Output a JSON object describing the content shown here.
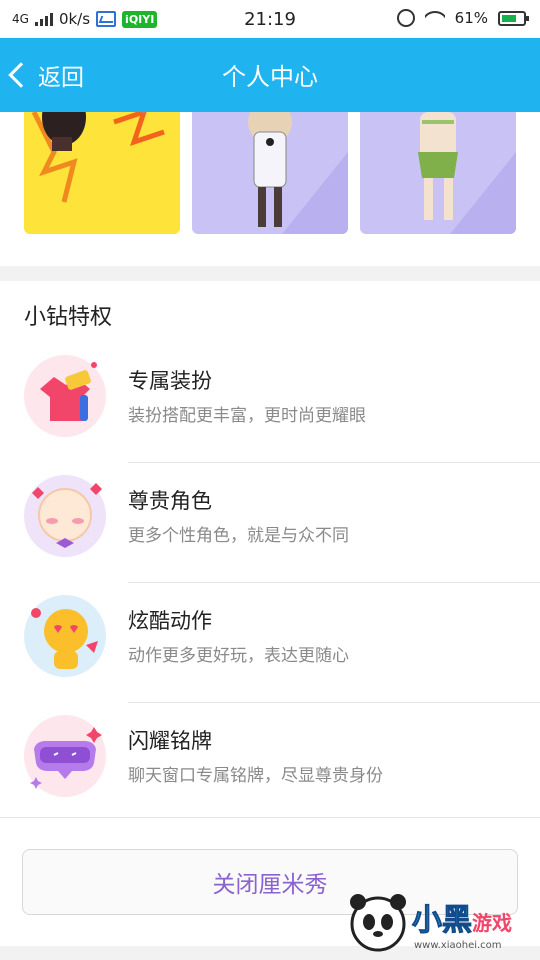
{
  "status_bar": {
    "network": "4G",
    "speed": "0k/s",
    "app_badge": "iQIYI",
    "time": "21:19",
    "battery": "61%"
  },
  "header": {
    "back_label": "返回",
    "title": "个人中心"
  },
  "privileges": {
    "title": "小钻特权",
    "items": [
      {
        "name": "专属装扮",
        "desc": "装扮搭配更丰富，更时尚更耀眼"
      },
      {
        "name": "尊贵角色",
        "desc": "更多个性角色，就是与众不同"
      },
      {
        "name": "炫酷动作",
        "desc": "动作更多更好玩，表达更随心"
      },
      {
        "name": "闪耀铭牌",
        "desc": "聊天窗口专属铭牌，尽显尊贵身份"
      }
    ]
  },
  "close_button": "关闭厘米秀",
  "watermark": {
    "brand": "小黑游戏",
    "url": "www.xiaohei.com"
  },
  "colors": {
    "accent": "#1fb4f0",
    "button_text": "#8b63cf"
  }
}
